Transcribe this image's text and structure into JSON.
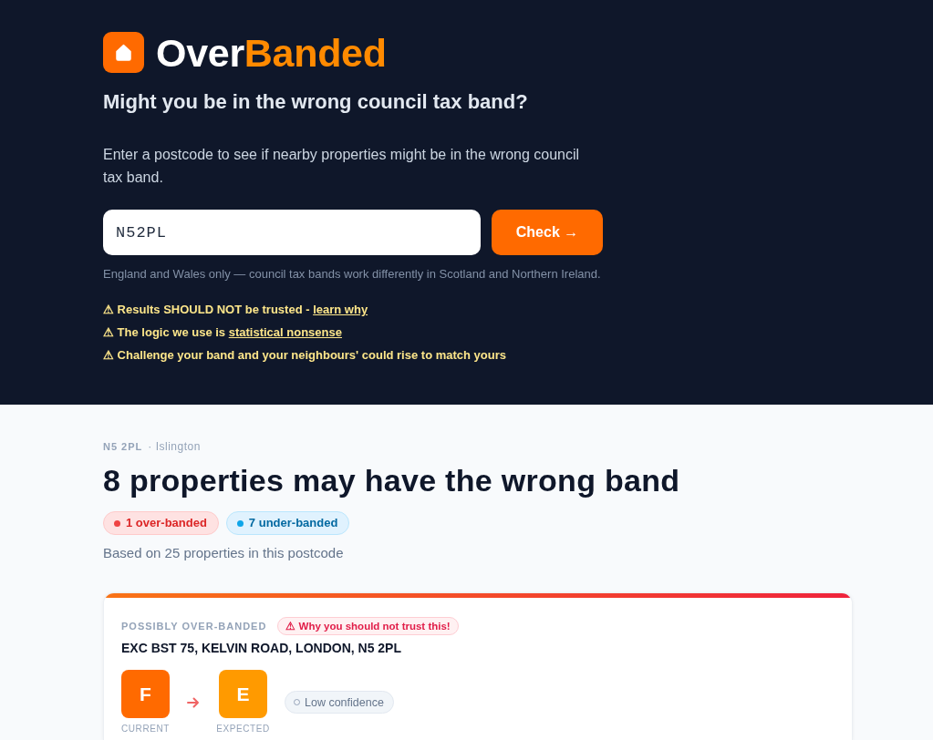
{
  "header": {
    "logo": {
      "parts": [
        "Over",
        "Banded"
      ]
    },
    "title": "Might you be in the wrong council tax band?",
    "intro": "Enter a postcode to see if nearby properties might be in the wrong council tax band.",
    "search": {
      "value": "N52PL",
      "button": "Check →"
    },
    "note": "England and Wales only — council tax bands work differently in Scotland and Northern Ireland.",
    "warnings": [
      {
        "text": "⚠ Results SHOULD NOT be trusted -",
        "link": "learn why"
      },
      {
        "text": "⚠ The logic we use is",
        "link": "statistical nonsense"
      },
      {
        "text": "⚠ Challenge your band and your neighbours' could rise to match yours"
      }
    ]
  },
  "summary": {
    "postcode": "N5 2PL",
    "area": "· Islington",
    "heading": "8 properties may have the wrong band",
    "counts": [
      {
        "kind": "over",
        "text": "1 over-banded"
      },
      {
        "kind": "under",
        "text": "7 under-banded"
      }
    ],
    "basis": "Based on 25 properties in this postcode"
  },
  "results": [
    {
      "kind": "over",
      "tag": "POSSIBLY OVER-BANDED",
      "warning": "⚠ Why you should not trust this!",
      "address": "EXC BST 75, KELVIN ROAD, LONDON, N5 2PL",
      "bands": [
        {
          "letter": "F",
          "label": "CURRENT",
          "color": "#ff6a00"
        },
        {
          "letter": "E",
          "label": "EXPECTED",
          "color": "#ff9a00"
        }
      ],
      "confidence": "Low confidence"
    }
  ]
}
